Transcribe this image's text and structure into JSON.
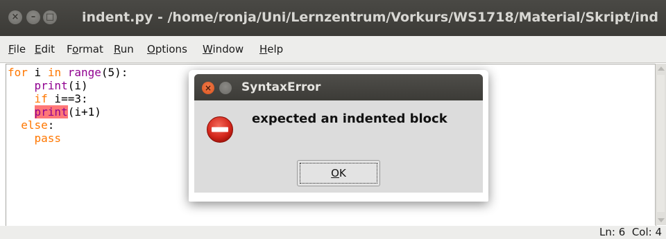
{
  "window": {
    "title": "indent.py - /home/ronja/Uni/Lernzentrum/Vorkurs/WS1718/Material/Skript/ind",
    "close_glyph": "×",
    "min_glyph": "–",
    "max_glyph": "□"
  },
  "menu": {
    "items": [
      {
        "mnemonic": "F",
        "rest": "ile"
      },
      {
        "mnemonic": "E",
        "rest": "dit"
      },
      {
        "pre": "F",
        "mnemonic": "o",
        "rest": "rmat"
      },
      {
        "mnemonic": "R",
        "rest": "un"
      },
      {
        "mnemonic": "O",
        "rest": "ptions"
      },
      {
        "mnemonic": "W",
        "rest": "indow"
      },
      {
        "mnemonic": "H",
        "rest": "elp"
      }
    ]
  },
  "editor": {
    "lines": [
      {
        "kw1": "for",
        "t1": " i ",
        "kw2": "in",
        "t2": " ",
        "bi": "range",
        "t3": "(5):"
      },
      {
        "indent": "    ",
        "bi": "print",
        "t": "(i)"
      },
      {
        "indent": "    ",
        "kw": "if",
        "t": " i==3:"
      },
      {
        "indent": "    ",
        "err": "print",
        "t": "(i+1)"
      },
      {
        "indent": "  ",
        "kw": "else",
        "t": ":"
      },
      {
        "indent": "    ",
        "kw": "pass"
      }
    ],
    "error_highlight_color": "#ff7777"
  },
  "status": {
    "line_label": "Ln: 6",
    "col_label": "Col: 4"
  },
  "dialog": {
    "title": "SyntaxError",
    "message": "expected an indented block",
    "ok_mnemonic": "O",
    "ok_rest": "K",
    "icon": "error-stop-icon"
  }
}
